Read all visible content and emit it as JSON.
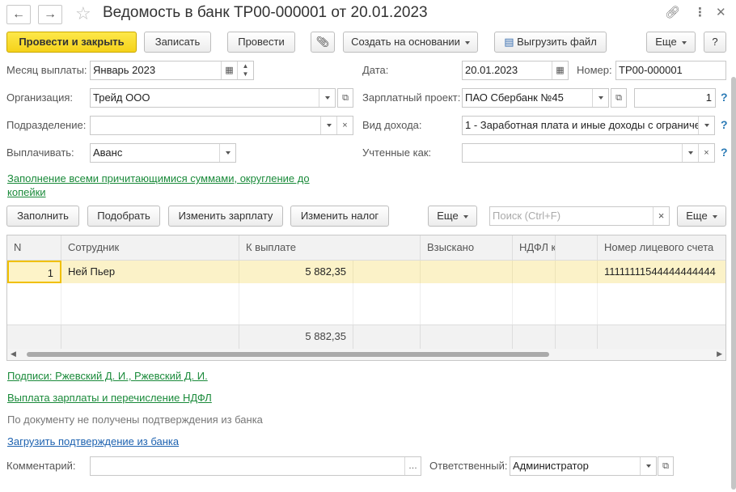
{
  "header": {
    "title": "Ведомость в банк ТР00-000001 от 20.01.2023",
    "back_icon": "arrow-left-icon",
    "forward_icon": "arrow-right-icon"
  },
  "toolbar": {
    "post_close": "Провести и закрыть",
    "save": "Записать",
    "post": "Провести",
    "create_based": "Создать на основании",
    "export": "Выгрузить файл",
    "more": "Еще",
    "help": "?"
  },
  "form": {
    "month_label": "Месяц выплаты:",
    "month_value": "Январь 2023",
    "date_label": "Дата:",
    "date_value": "20.01.2023",
    "number_label": "Номер:",
    "number_value": "ТР00-000001",
    "org_label": "Организация:",
    "org_value": "Трейд ООО",
    "salary_project_label": "Зарплатный проект:",
    "salary_project_value": "ПАО Сбербанк №45",
    "salary_project_count": "1",
    "dept_label": "Подразделение:",
    "dept_value": "",
    "income_label": "Вид дохода:",
    "income_value": "1 - Заработная плата и иные доходы с ограниче",
    "pay_label": "Выплачивать:",
    "pay_value": "Аванс",
    "counted_label": "Учтенные как:",
    "counted_value": "",
    "fill_link_line1": "Заполнение всеми причитающимися суммами, округление до",
    "fill_link_line2": "копейки"
  },
  "table_toolbar": {
    "fill": "Заполнить",
    "select": "Подобрать",
    "change_salary": "Изменить зарплату",
    "change_tax": "Изменить налог",
    "more1": "Еще",
    "search_placeholder": "Поиск (Ctrl+F)",
    "search_clear": "×",
    "more2": "Еще"
  },
  "table": {
    "columns": [
      "N",
      "Сотрудник",
      "К выплате",
      "Взыскано",
      "НДФЛ к пер...",
      "",
      "Номер лицевого счета"
    ],
    "rows": [
      {
        "n": "1",
        "employee": "Ней Пьер",
        "amount": "5 882,35",
        "withheld": "",
        "ndfl": "",
        "extra": "",
        "account": "11111111544444444444"
      }
    ],
    "footer_amount": "5 882,35"
  },
  "links": {
    "signatures": "Подписи: Ржевский Д. И., Ржевский Д. И.",
    "payment": "Выплата зарплаты и перечисление НДФЛ",
    "no_confirm": "По документу не получены подтверждения из банка",
    "load_confirm": "Загрузить подтверждение из банка"
  },
  "bottom": {
    "comment_label": "Комментарий:",
    "comment_value": "",
    "responsible_label": "Ответственный:",
    "responsible_value": "Администратор"
  }
}
